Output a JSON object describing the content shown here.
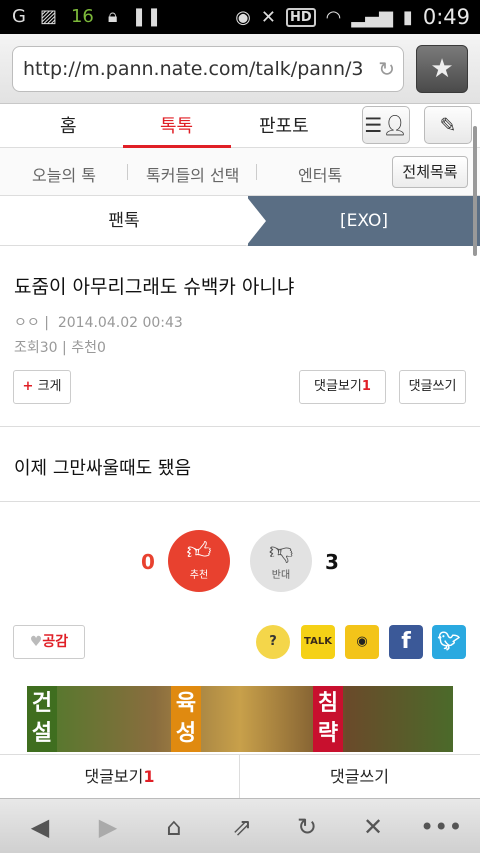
{
  "status_bar": {
    "notif_count": "16",
    "time": "0:49",
    "hd_label": "HD"
  },
  "browser": {
    "url": "http://m.pann.nate.com/talk/pann/3",
    "colors": {
      "accent": "#e01f26",
      "breadcrumb_bg": "#5a6e84"
    }
  },
  "main_nav": {
    "tabs": [
      "홈",
      "톡톡",
      "판포토"
    ],
    "active_tab": "톡톡"
  },
  "sub_nav": {
    "items": [
      "오늘의 톡",
      "톡커들의 선택",
      "엔터톡"
    ],
    "all_list_label": "전체목록"
  },
  "breadcrumb": {
    "left": "팬톡",
    "right": "[EXO]"
  },
  "post": {
    "title": "됴줌이 아무리그래도 슈백카 아니냐",
    "author": "ㅇㅇ",
    "date": "2014.04.02 00:43",
    "views_label": "조회",
    "views": "30",
    "recommend_label": "추천",
    "recommend": "0",
    "enlarge_label": "크게",
    "view_comments_label": "댓글보기",
    "comment_count": "1",
    "write_comment_label": "댓글쓰기",
    "body": "이제 그만싸울때도 됐음"
  },
  "votes": {
    "up_count": "0",
    "up_label": "추천",
    "down_count": "3",
    "down_label": "반대"
  },
  "share": {
    "like_label": "공감",
    "kakaotalk_label": "TALK",
    "facebook_label": "f"
  },
  "banner": {
    "left_text": "건설",
    "mid_text": "육성",
    "right_text": "침략"
  },
  "bottom_bar": {
    "view_comments_label": "댓글보기",
    "comment_count": "1",
    "write_comment_label": "댓글쓰기"
  }
}
